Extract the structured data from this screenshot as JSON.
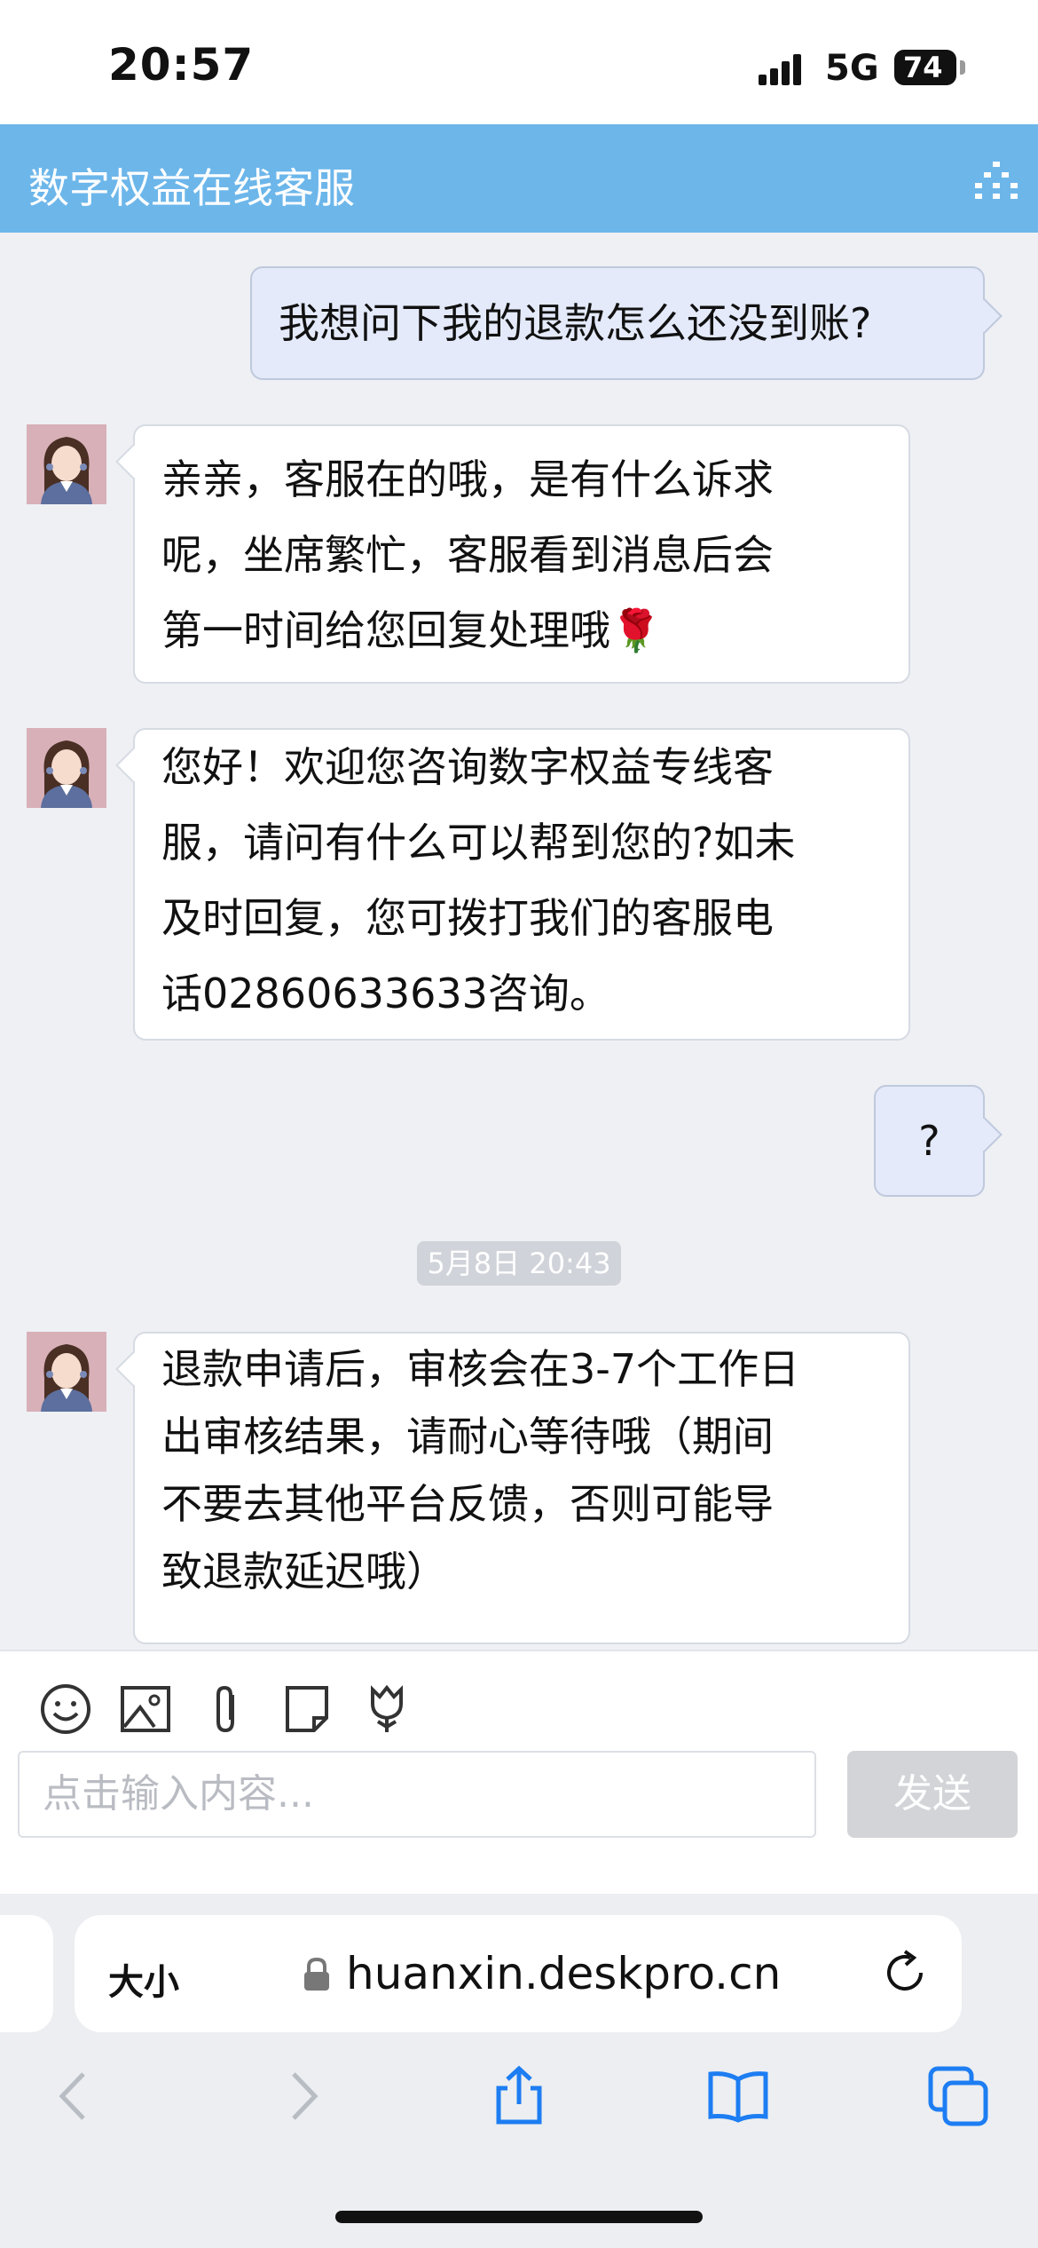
{
  "status_bar": {
    "time": "20:57",
    "network": "5G",
    "battery": "74"
  },
  "header": {
    "title": "数字权益在线客服"
  },
  "messages": [
    {
      "from": "user",
      "text": "我想问下我的退款怎么还没到账?"
    },
    {
      "from": "agent",
      "lines": [
        "亲亲，客服在的哦，是有什么诉求",
        "呢，坐席繁忙，客服看到消息后会",
        "第一时间给您回复处理哦"
      ],
      "emoji": "🌹"
    },
    {
      "from": "agent",
      "lines": [
        "您好！欢迎您咨询数字权益专线客",
        "服，请问有什么可以帮到您的?如未",
        "及时回复，您可拨打我们的客服电",
        "话02860633633咨询。"
      ]
    },
    {
      "from": "user",
      "text": "?"
    },
    {
      "from": "agent",
      "lines": [
        "退款申请后，审核会在3-7个工作日",
        "出审核结果，请耐心等待哦（期间",
        "不要去其他平台反馈，否则可能导",
        "致退款延迟哦）"
      ]
    }
  ],
  "timestamp": "5月8日 20:43",
  "composer": {
    "placeholder": "点击输入内容...",
    "send_label": "发送"
  },
  "browser": {
    "text_size_label": "大小",
    "url": "huanxin.deskpro.cn"
  },
  "colors": {
    "header_bg": "#6cb6ea",
    "outgoing_bubble": "#e4eafa",
    "send_disabled": "#d2d4d8",
    "browser_blue": "#1d7df2"
  }
}
